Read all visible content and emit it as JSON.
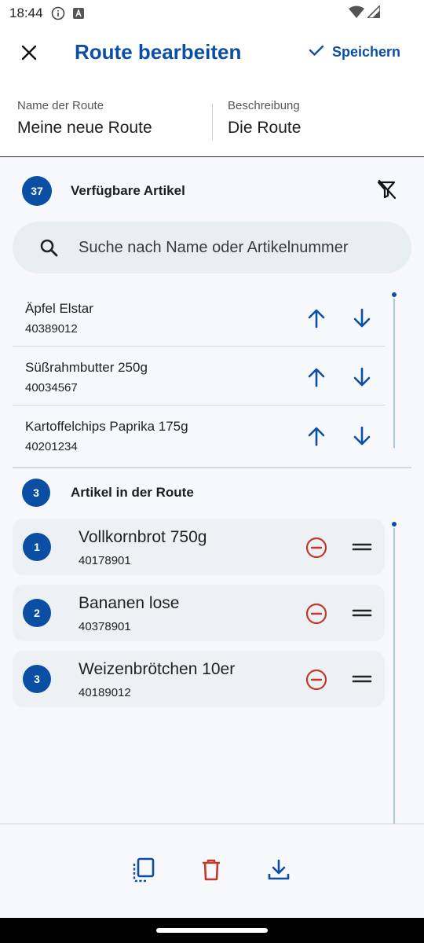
{
  "status_bar": {
    "time": "18:44",
    "icons": [
      "info-icon",
      "a-badge-icon",
      "wifi-icon",
      "signal-icon"
    ]
  },
  "app_bar": {
    "title": "Route bearbeiten",
    "save_label": "Speichern",
    "close_icon": "close-icon",
    "save_icon": "check-icon",
    "accent_color": "#0b4fa5"
  },
  "fields": {
    "name": {
      "label": "Name der Route",
      "value": "Meine neue Route"
    },
    "description": {
      "label": "Beschreibung",
      "value": "Die Route"
    }
  },
  "available": {
    "count": "37",
    "title": "Verfügbare Artikel",
    "filter_icon": "filter-off-icon",
    "search": {
      "placeholder": "Suche nach Name oder Artikelnummer",
      "value": ""
    },
    "items": [
      {
        "name": "Äpfel Elstar",
        "number": "40389012"
      },
      {
        "name": "Süßrahmbutter 250g",
        "number": "40034567"
      },
      {
        "name": "Kartoffelchips Paprika 175g",
        "number": "40201234"
      }
    ]
  },
  "route": {
    "count": "3",
    "title": "Artikel in der Route",
    "items": [
      {
        "position": "1",
        "name": "Vollkornbrot 750g",
        "number": "40178901"
      },
      {
        "position": "2",
        "name": "Bananen lose",
        "number": "40378901"
      },
      {
        "position": "3",
        "name": "Weizenbrötchen 10er",
        "number": "40189012"
      }
    ],
    "remove_color": "#c0392b"
  },
  "bottom_bar": {
    "actions": [
      "copy-icon",
      "delete-icon",
      "download-icon"
    ],
    "delete_color": "#c0392b"
  }
}
